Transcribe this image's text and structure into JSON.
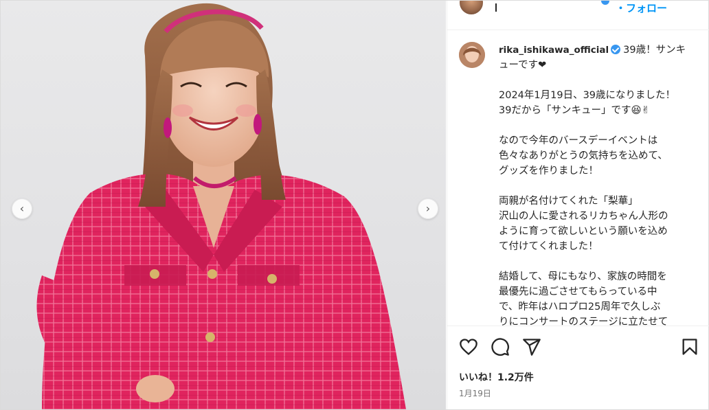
{
  "post": {
    "username": "rika_ishikawa_official",
    "follow_label": "・フォロー",
    "caption_first": "39歳！サンキューです❤",
    "caption_paragraphs": [
      "2024年1月19日、39歳になりました！\n39だから「サンキュー」です😆✌",
      "なので今年のバースデーイベントは\n色々なありがとうの気持ちを込めて、\nグッズを作りました！",
      "両親が名付けてくれた「梨華」\n沢山の人に愛されるリカちゃん人形の\nように育って欲しいという願いを込め\nて付けてくれました！",
      "結婚して、母にもなり、家族の時間を\n最優先に過ごさせてもらっている中\nで、昨年はハロプロ25周年で久しぶ\nりにコンサートのステージに立たせて\nもらい、仲間たちと一緒に歌って踊れ"
    ],
    "likes": "いいね！1.2万件",
    "date": "1月19日"
  },
  "icons": {
    "prev": "chevron-left-icon",
    "next": "chevron-right-icon",
    "like": "heart-icon",
    "comment": "comment-icon",
    "share": "share-icon",
    "save": "bookmark-icon"
  },
  "colors": {
    "accent": "#0095f6",
    "verified": "#3897f0",
    "jacket": "#e0245e"
  }
}
